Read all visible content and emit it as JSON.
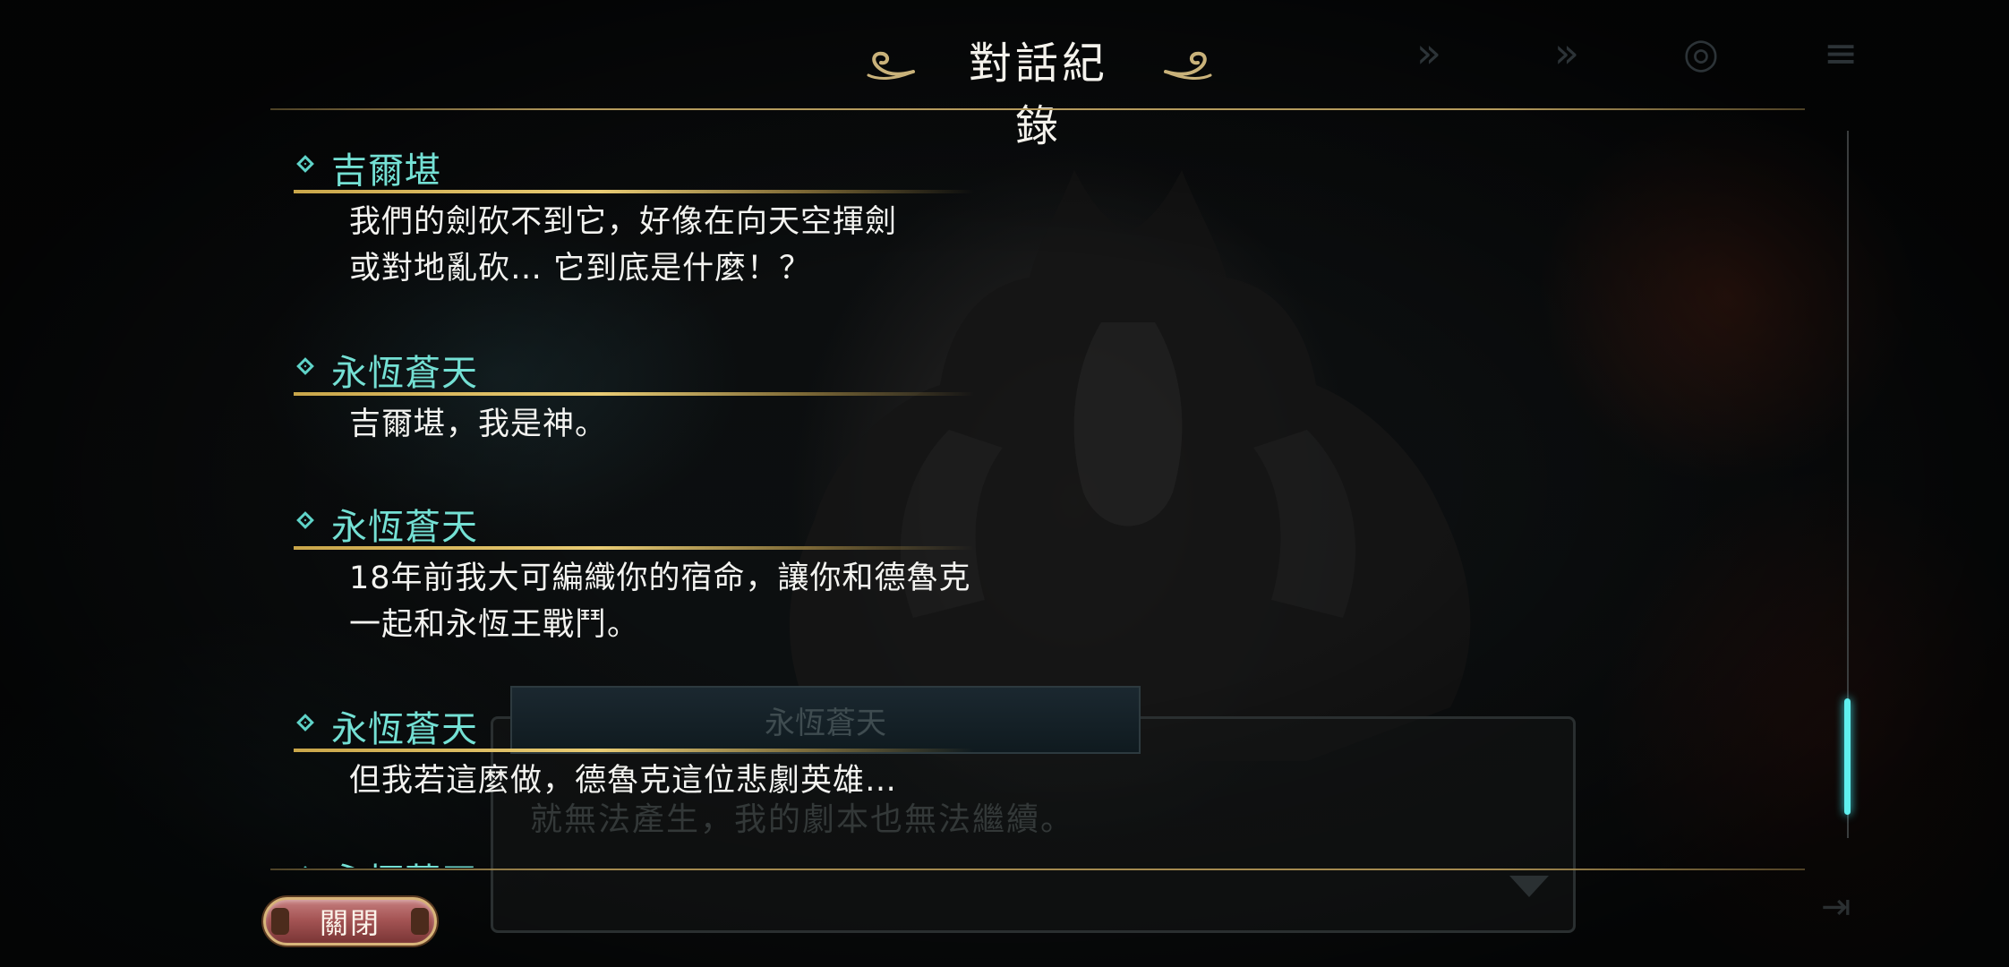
{
  "window": {
    "title": "對話紀錄"
  },
  "game": {
    "speaker": "永恆蒼天",
    "text": "就無法產生，我的劇本也無法繼續。",
    "top_icons": [
      "fast-forward-icon",
      "skip-icon",
      "auto-icon",
      "log-icon"
    ]
  },
  "log": {
    "entries": [
      {
        "speaker": "吉爾堪",
        "lines": [
          "我們的劍砍不到它，好像在向天空揮劍",
          "或對地亂砍… 它到底是什麼！？"
        ]
      },
      {
        "speaker": "永恆蒼天",
        "lines": [
          "吉爾堪，我是神。"
        ]
      },
      {
        "speaker": "永恆蒼天",
        "lines": [
          "18年前我大可編織你的宿命，讓你和德魯克",
          "一起和永恆王戰鬥。"
        ]
      },
      {
        "speaker": "永恆蒼天",
        "lines": [
          "但我若這麼做，德魯克這位悲劇英雄…"
        ]
      },
      {
        "speaker": "永恆蒼天",
        "lines": []
      }
    ]
  },
  "buttons": {
    "close_label": "關閉"
  },
  "colors": {
    "speaker": "#74e0d4",
    "accent_gold": "#d8b963",
    "scroll_thumb": "#5ff0ef"
  }
}
